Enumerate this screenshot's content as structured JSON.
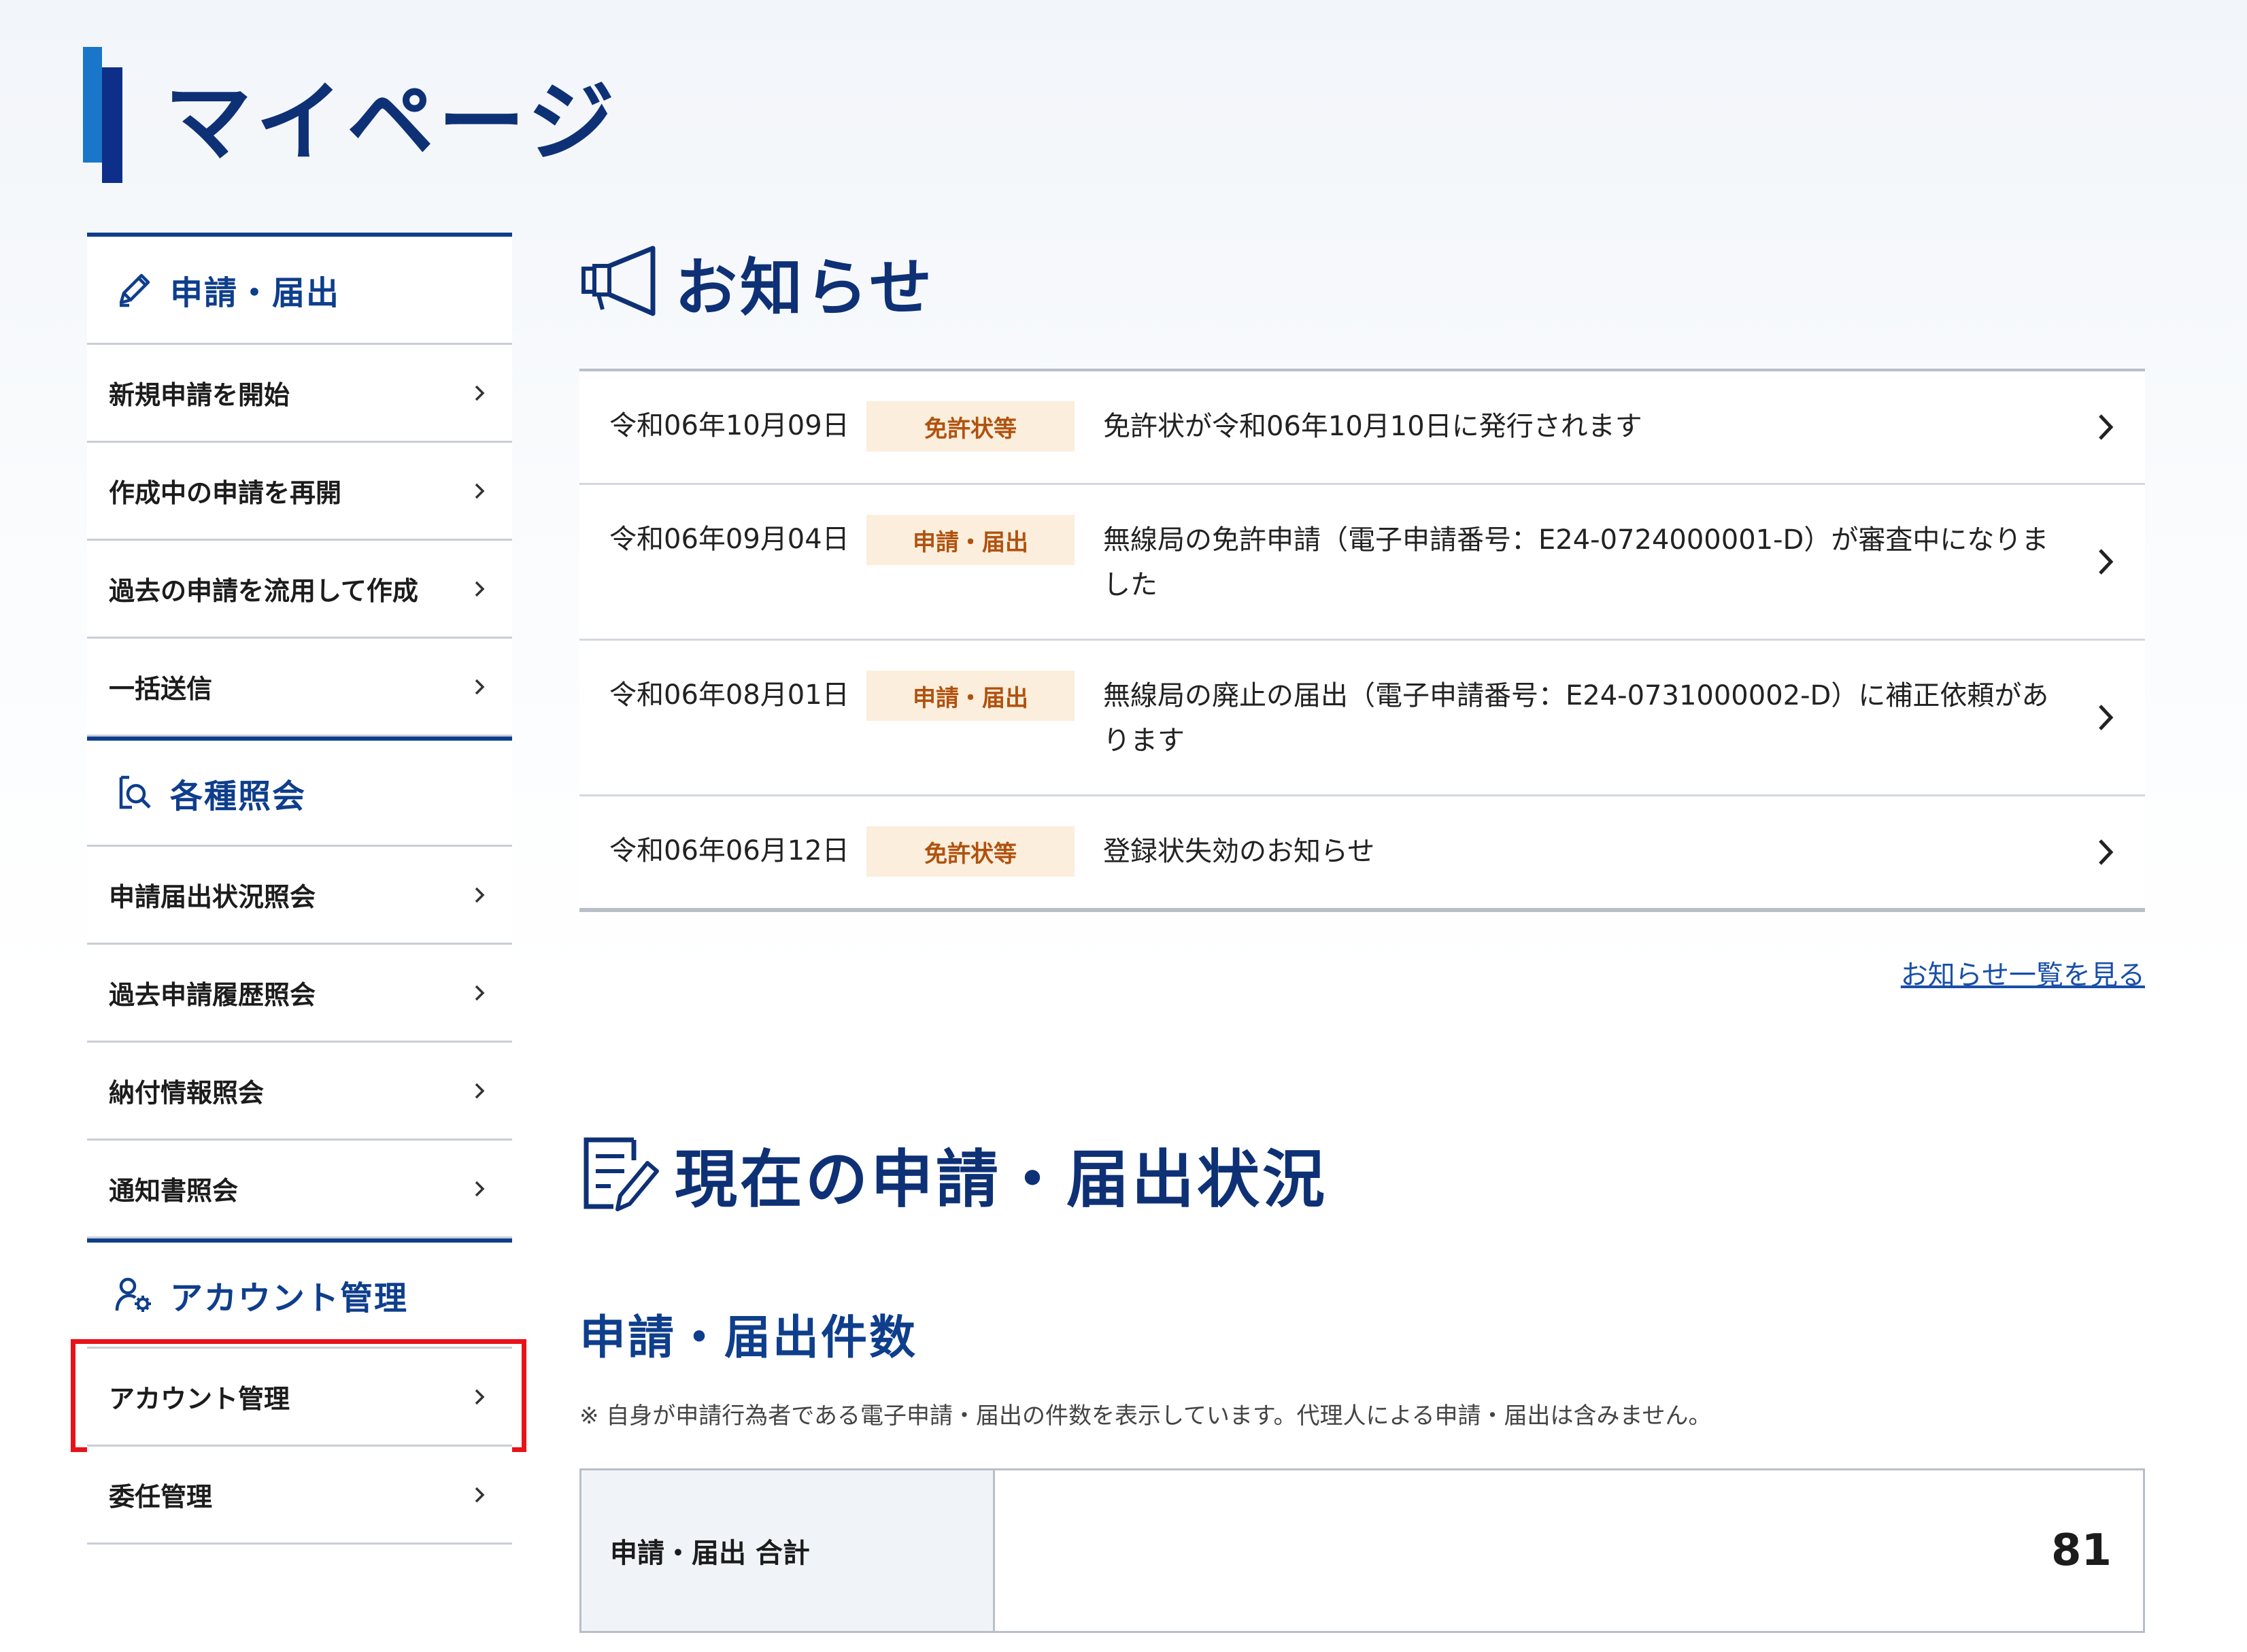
{
  "page": {
    "title": "マイページ"
  },
  "sidebar": {
    "sections": [
      {
        "heading": "申請・届出",
        "icon": "pencil-icon",
        "items": [
          "新規申請を開始",
          "作成中の申請を再開",
          "過去の申請を流用して作成",
          "一括送信"
        ]
      },
      {
        "heading": "各種照会",
        "icon": "document-search-icon",
        "items": [
          "申請届出状況照会",
          "過去申請履歴照会",
          "納付情報照会",
          "通知書照会"
        ]
      },
      {
        "heading": "アカウント管理",
        "icon": "user-gear-icon",
        "items": [
          "アカウント管理",
          "委任管理"
        ]
      }
    ],
    "highlighted_item": "アカウント管理"
  },
  "notices": {
    "heading": "お知らせ",
    "icon": "megaphone-icon",
    "items": [
      {
        "date": "令和06年10月09日",
        "tag": "免許状等",
        "text": "免許状が令和06年10月10日に発行されます"
      },
      {
        "date": "令和06年09月04日",
        "tag": "申請・届出",
        "text": "無線局の免許申請（電子申請番号：E24-0724000001-D）が審査中になりました"
      },
      {
        "date": "令和06年08月01日",
        "tag": "申請・届出",
        "text": "無線局の廃止の届出（電子申請番号：E24-0731000002-D）に補正依頼があります"
      },
      {
        "date": "令和06年06月12日",
        "tag": "免許状等",
        "text": "登録状失効のお知らせ"
      }
    ],
    "more_link": "お知らせ一覧を見る"
  },
  "status": {
    "heading": "現在の申請・届出状況",
    "icon": "document-edit-icon",
    "count_heading": "申請・届出件数",
    "note": "※ 自身が申請行為者である電子申請・届出の件数を表示しています。代理人による申請・届出は含みません。",
    "total_label": "申請・届出 合計",
    "total_value": "81"
  },
  "colors": {
    "navy": "#0e3176",
    "accent_blue": "#1976c8",
    "tag_bg": "#fbeedd",
    "tag_text": "#b0520e",
    "highlight_red": "#e8131a"
  }
}
